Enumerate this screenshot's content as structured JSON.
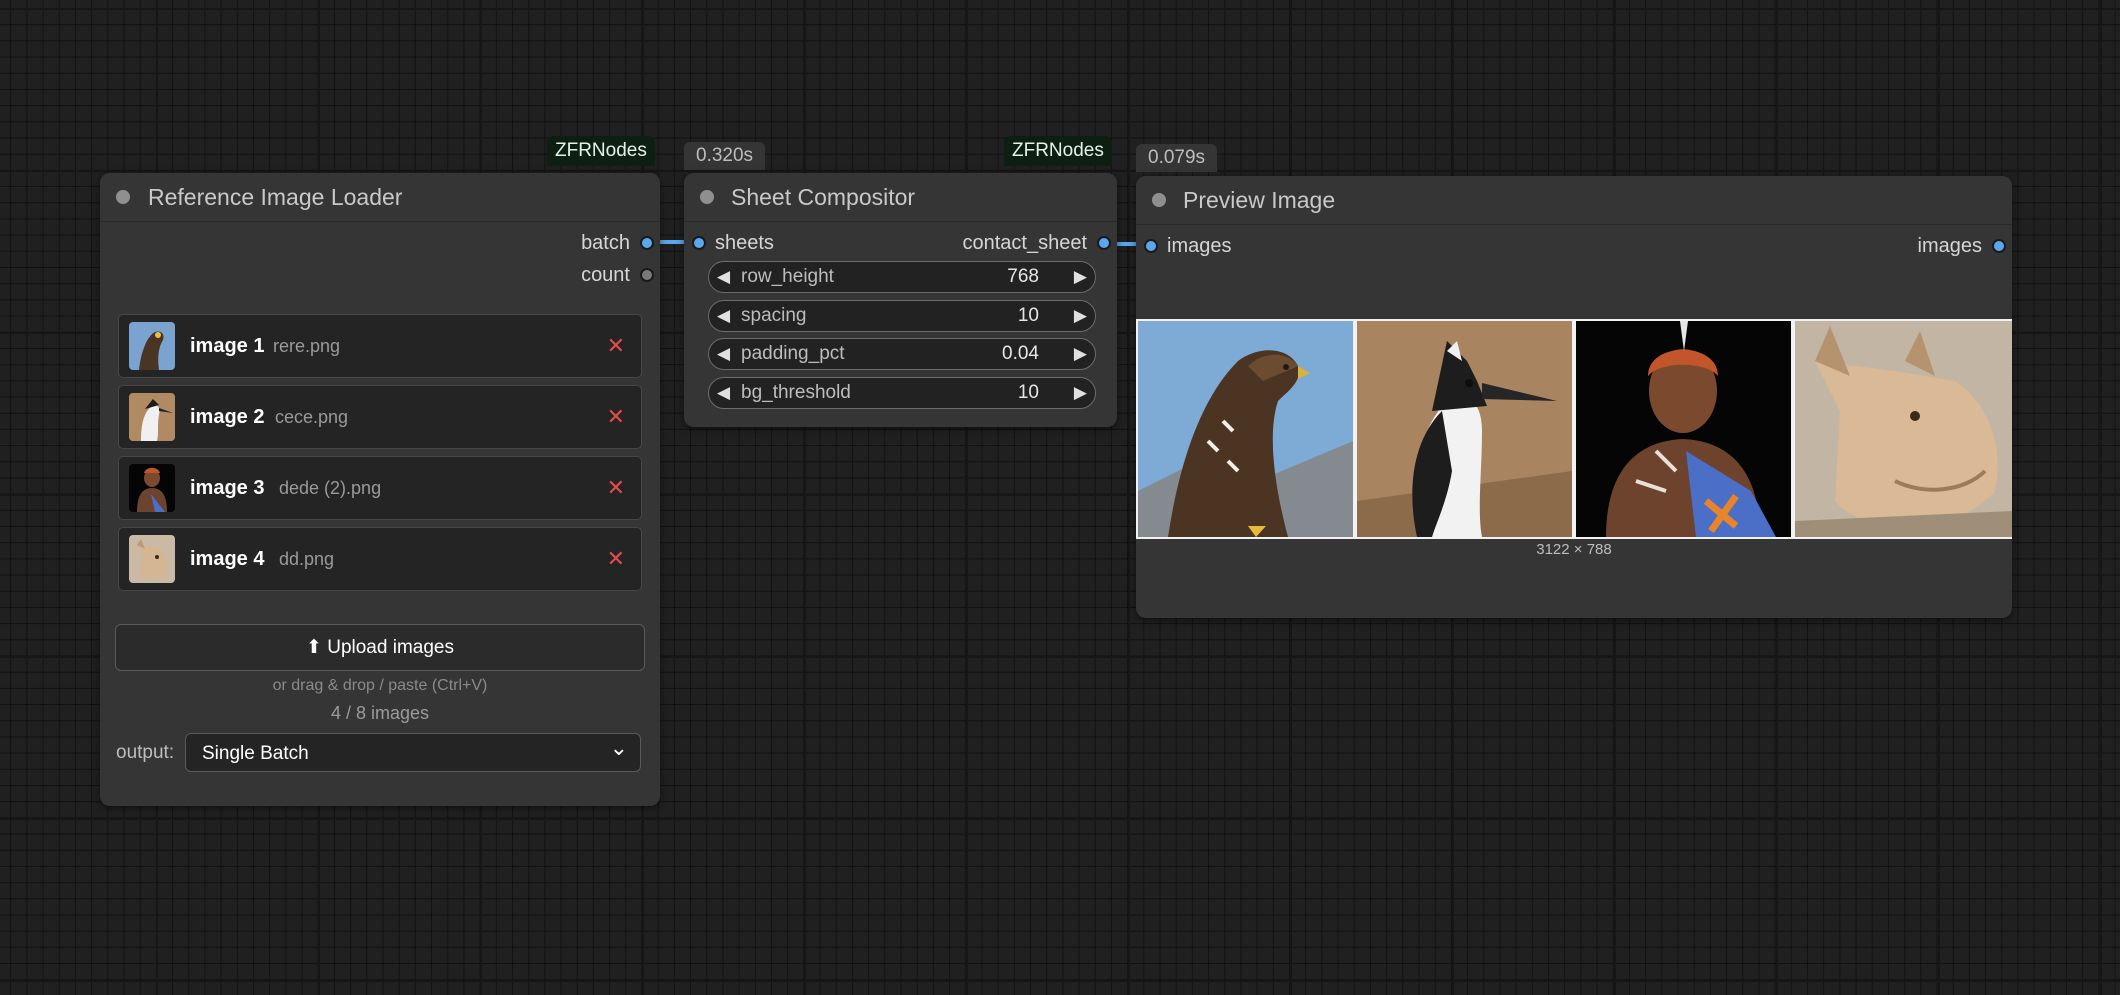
{
  "badges": {
    "loader_source": "ZFRNodes",
    "compositor_time": "0.320s",
    "compositor_source": "ZFRNodes",
    "preview_time": "0.079s"
  },
  "loader": {
    "title": "Reference Image Loader",
    "outputs": {
      "batch": "batch",
      "count": "count"
    },
    "images": [
      {
        "label": "image 1",
        "filename": "rere.png"
      },
      {
        "label": "image 2",
        "filename": "cece.png"
      },
      {
        "label": "image 3",
        "filename": "dede (2).png"
      },
      {
        "label": "image 4",
        "filename": "dd.png"
      }
    ],
    "remove_glyph": "✕",
    "upload_label": "⬆ Upload images",
    "upload_hint": "or drag & drop / paste (Ctrl+V)",
    "count_text": "4 / 8 images",
    "output_label": "output:",
    "output_value": "Single Batch",
    "select_arrow": "⌄"
  },
  "compositor": {
    "title": "Sheet Compositor",
    "input": "sheets",
    "output": "contact_sheet",
    "widgets": [
      {
        "name": "row_height",
        "value": "768"
      },
      {
        "name": "spacing",
        "value": "10"
      },
      {
        "name": "padding_pct",
        "value": "0.04"
      },
      {
        "name": "bg_threshold",
        "value": "10"
      }
    ],
    "left_arrow": "◀",
    "right_arrow": "▶"
  },
  "preview": {
    "title": "Preview Image",
    "input": "images",
    "output": "images",
    "dimensions": "3122 × 788"
  },
  "colors": {
    "link": "#5aa7ef",
    "canvas": "#202020",
    "node": "#353535",
    "delete": "#e34b4b"
  }
}
